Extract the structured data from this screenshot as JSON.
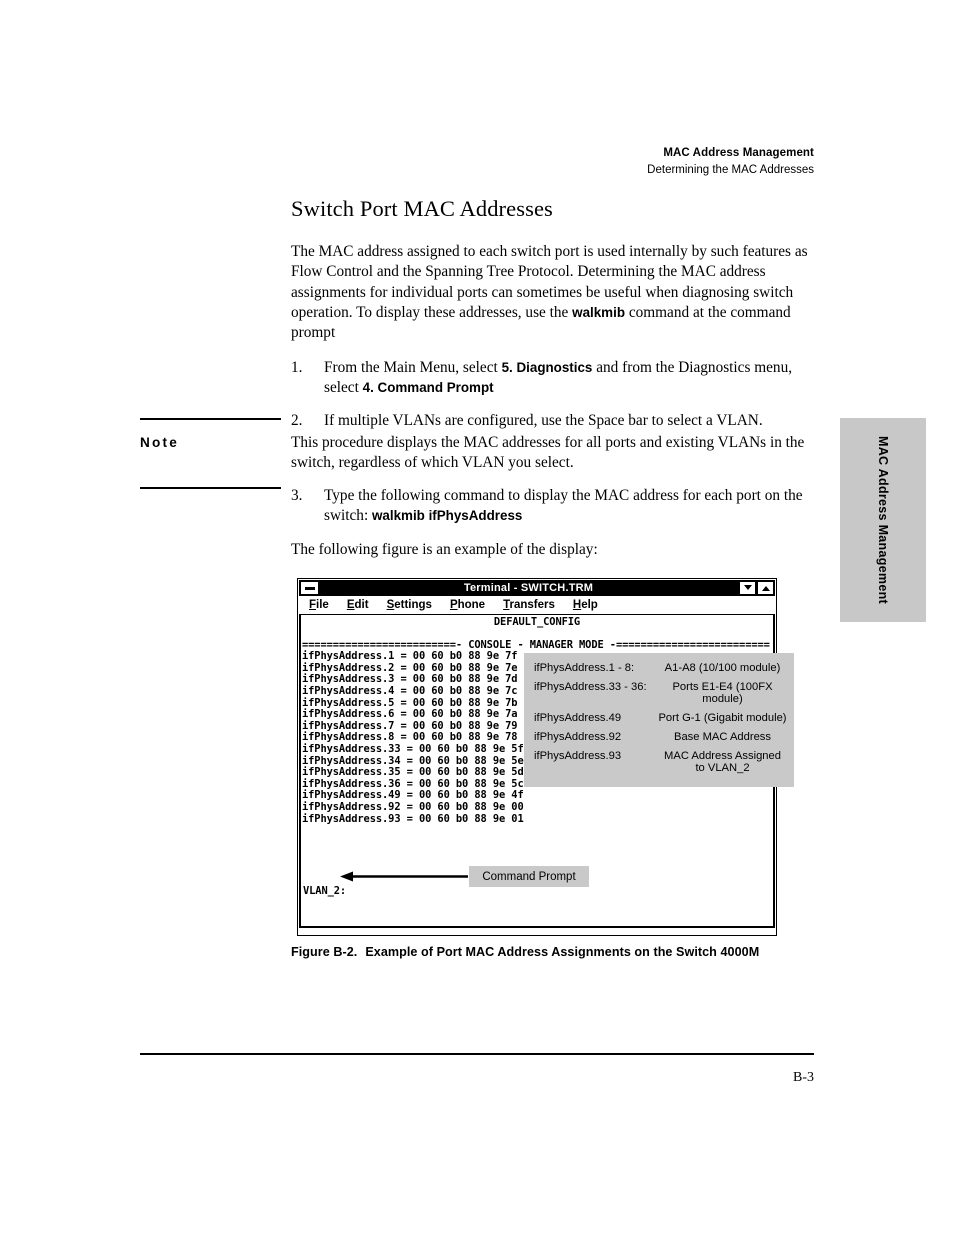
{
  "header": {
    "title": "MAC Address Management",
    "subtitle": "Determining the MAC Addresses"
  },
  "thumb_tab": {
    "label": "MAC Address Management"
  },
  "page": {
    "title": "Switch Port MAC Addresses",
    "intro_1": "The MAC address assigned to each switch port is used internally by such features as Flow Control and the Spanning Tree Protocol. Determining the MAC address assignments for individual ports can sometimes be useful when diagnosing switch operation. To display these addresses, use the ",
    "intro_bold": "walkmib",
    "intro_2": " command at the command prompt",
    "steps": [
      {
        "num": "1.",
        "text_1": "From the Main Menu, select ",
        "bold_1": "5. Diagnostics",
        "text_2": " and from the Diagnostics menu, select  ",
        "bold_2": "4. Command Prompt",
        "text_3": ""
      },
      {
        "num": "2.",
        "text_1": "If multiple VLANs are configured, use the Space bar to select a VLAN.",
        "bold_1": "",
        "text_2": "",
        "bold_2": "",
        "text_3": ""
      }
    ],
    "note": {
      "label": "Note",
      "text": "This procedure displays the MAC addresses for all ports and existing VLANs in the switch, regardless of which VLAN you select."
    },
    "step3": {
      "num": "3.",
      "text_1": "Type the following command to display the MAC address for each port on the switch:  ",
      "bold_1": "walkmib ifPhysAddress"
    },
    "figure_lead": "The following figure is an example of the display:",
    "figure_caption_no": "Figure B-2.",
    "figure_caption_text": "Example of Port MAC Address Assignments on the Switch 4000M",
    "page_number": "B-3"
  },
  "terminal": {
    "window_title": "Terminal - SWITCH.TRM",
    "menu": [
      {
        "accel": "F",
        "rest": "ile"
      },
      {
        "accel": "E",
        "rest": "dit"
      },
      {
        "accel": "S",
        "rest": "ettings"
      },
      {
        "accel": "P",
        "rest": "hone"
      },
      {
        "accel": "T",
        "rest": "ransfers"
      },
      {
        "accel": "H",
        "rest": "elp"
      }
    ],
    "config_line": "DEFAULT_CONFIG",
    "separator_line": "=========================- CONSOLE - MANAGER MODE -=========================",
    "output_lines": [
      "ifPhysAddress.1 = 00 60 b0 88 9e 7f",
      "ifPhysAddress.2 = 00 60 b0 88 9e 7e",
      "ifPhysAddress.3 = 00 60 b0 88 9e 7d",
      "ifPhysAddress.4 = 00 60 b0 88 9e 7c",
      "ifPhysAddress.5 = 00 60 b0 88 9e 7b",
      "ifPhysAddress.6 = 00 60 b0 88 9e 7a",
      "ifPhysAddress.7 = 00 60 b0 88 9e 79",
      "ifPhysAddress.8 = 00 60 b0 88 9e 78",
      "ifPhysAddress.33 = 00 60 b0 88 9e 5f",
      "ifPhysAddress.34 = 00 60 b0 88 9e 5e",
      "ifPhysAddress.35 = 00 60 b0 88 9e 5d",
      "ifPhysAddress.36 = 00 60 b0 88 9e 5c",
      "ifPhysAddress.49 = 00 60 b0 88 9e 4f",
      "ifPhysAddress.92 = 00 60 b0 88 9e 00",
      "ifPhysAddress.93 = 00 60 b0 88 9e 01"
    ],
    "prompt_line": "VLAN_2:",
    "sysmenu_icon": "minimize-box-icon",
    "min_icon": "chevron-down-icon",
    "max_icon": "chevron-up-icon"
  },
  "callouts": {
    "legend_rows": [
      {
        "key": "ifPhysAddress.1 - 8:",
        "value": "A1-A8 (10/100 module)"
      },
      {
        "key": "ifPhysAddress.33 - 36:",
        "value": "Ports E1-E4 (100FX module)"
      },
      {
        "key": "ifPhysAddress.49",
        "value": "Port G-1 (Gigabit module)"
      },
      {
        "key": "ifPhysAddress.92",
        "value": "Base MAC Address"
      },
      {
        "key": "ifPhysAddress.93",
        "value": "MAC Address Assigned\nto VLAN_2"
      }
    ],
    "prompt_label": "Command Prompt"
  },
  "colors": {
    "callout_gray": "#c9c9c9",
    "tab_gray": "#c8c8c8",
    "titlebar": "#000000",
    "page_bg": "#ffffff"
  }
}
